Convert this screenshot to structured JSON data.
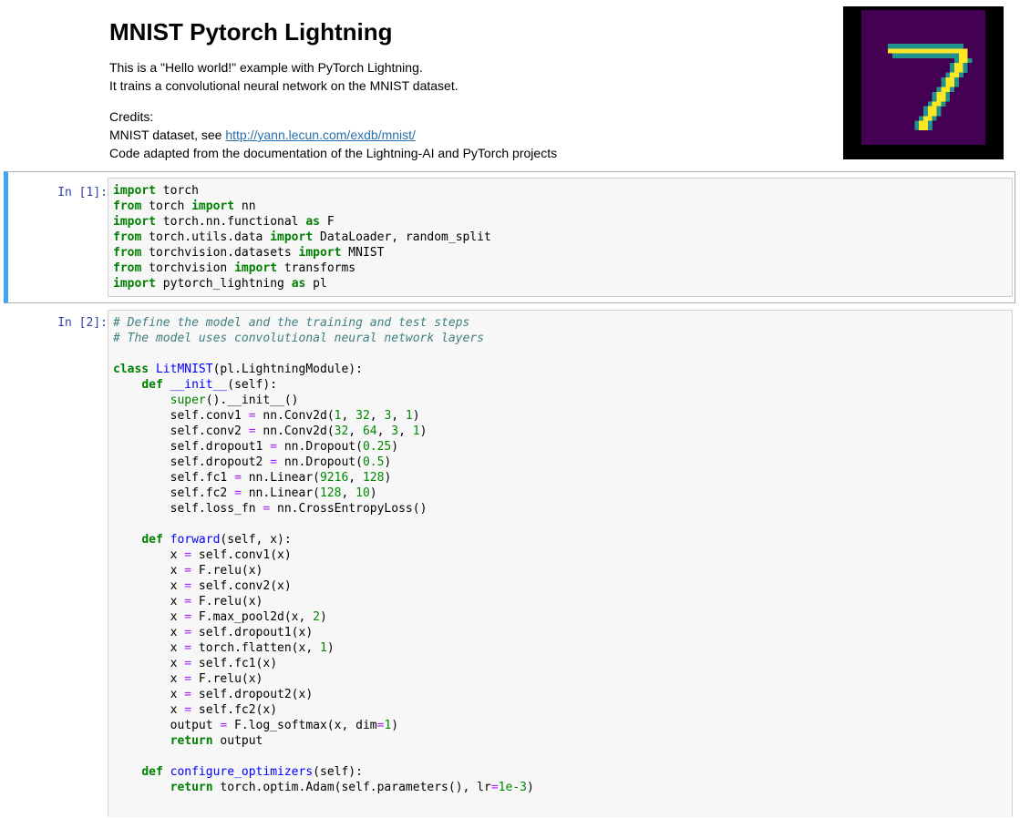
{
  "markdown": {
    "title": "MNIST Pytorch Lightning",
    "intro_line1": "This is a \"Hello world!\" example with PyTorch Lightning.",
    "intro_line2": "It trains a convolutional neural network on the MNIST dataset.",
    "credits_heading": "Credits:",
    "credits_dataset_prefix": "MNIST dataset, see ",
    "credits_dataset_link": "http://yann.lecun.com/exdb/mnist/",
    "credits_code": "Code adapted from the documentation of the Lightning-AI and PyTorch projects"
  },
  "image": {
    "description_colors": {
      "background": "#440154",
      "stroke": "#fde725",
      "edge": "#21918c"
    }
  },
  "cells": [
    {
      "prompt": "In [1]:",
      "lines": [
        [
          [
            "kw",
            "import"
          ],
          [
            "t",
            " torch"
          ]
        ],
        [
          [
            "kw",
            "from"
          ],
          [
            "t",
            " torch "
          ],
          [
            "kw",
            "import"
          ],
          [
            "t",
            " nn"
          ]
        ],
        [
          [
            "kw",
            "import"
          ],
          [
            "t",
            " torch.nn.functional "
          ],
          [
            "kw",
            "as"
          ],
          [
            "t",
            " F"
          ]
        ],
        [
          [
            "kw",
            "from"
          ],
          [
            "t",
            " torch.utils.data "
          ],
          [
            "kw",
            "import"
          ],
          [
            "t",
            " DataLoader, random_split"
          ]
        ],
        [
          [
            "kw",
            "from"
          ],
          [
            "t",
            " torchvision.datasets "
          ],
          [
            "kw",
            "import"
          ],
          [
            "t",
            " MNIST"
          ]
        ],
        [
          [
            "kw",
            "from"
          ],
          [
            "t",
            " torchvision "
          ],
          [
            "kw",
            "import"
          ],
          [
            "t",
            " transforms"
          ]
        ],
        [
          [
            "kw",
            "import"
          ],
          [
            "t",
            " pytorch_lightning "
          ],
          [
            "kw",
            "as"
          ],
          [
            "t",
            " pl"
          ]
        ]
      ]
    },
    {
      "prompt": "In [2]:",
      "lines": [
        [
          [
            "cm",
            "# Define the model and the training and test steps"
          ]
        ],
        [
          [
            "cm",
            "# The model uses convolutional neural network layers"
          ]
        ],
        [],
        [
          [
            "kw",
            "class"
          ],
          [
            "t",
            " "
          ],
          [
            "fn",
            "LitMNIST"
          ],
          [
            "t",
            "(pl.LightningModule):"
          ]
        ],
        [
          [
            "t",
            "    "
          ],
          [
            "kw",
            "def"
          ],
          [
            "t",
            " "
          ],
          [
            "fn",
            "__init__"
          ],
          [
            "t",
            "(self):"
          ]
        ],
        [
          [
            "t",
            "        "
          ],
          [
            "bi",
            "super"
          ],
          [
            "t",
            "().__init__()"
          ]
        ],
        [
          [
            "t",
            "        self.conv1 "
          ],
          [
            "op",
            "="
          ],
          [
            "t",
            " nn.Conv2d("
          ],
          [
            "num",
            "1"
          ],
          [
            "t",
            ", "
          ],
          [
            "num",
            "32"
          ],
          [
            "t",
            ", "
          ],
          [
            "num",
            "3"
          ],
          [
            "t",
            ", "
          ],
          [
            "num",
            "1"
          ],
          [
            "t",
            ")"
          ]
        ],
        [
          [
            "t",
            "        self.conv2 "
          ],
          [
            "op",
            "="
          ],
          [
            "t",
            " nn.Conv2d("
          ],
          [
            "num",
            "32"
          ],
          [
            "t",
            ", "
          ],
          [
            "num",
            "64"
          ],
          [
            "t",
            ", "
          ],
          [
            "num",
            "3"
          ],
          [
            "t",
            ", "
          ],
          [
            "num",
            "1"
          ],
          [
            "t",
            ")"
          ]
        ],
        [
          [
            "t",
            "        self.dropout1 "
          ],
          [
            "op",
            "="
          ],
          [
            "t",
            " nn.Dropout("
          ],
          [
            "num",
            "0.25"
          ],
          [
            "t",
            ")"
          ]
        ],
        [
          [
            "t",
            "        self.dropout2 "
          ],
          [
            "op",
            "="
          ],
          [
            "t",
            " nn.Dropout("
          ],
          [
            "num",
            "0.5"
          ],
          [
            "t",
            ")"
          ]
        ],
        [
          [
            "t",
            "        self.fc1 "
          ],
          [
            "op",
            "="
          ],
          [
            "t",
            " nn.Linear("
          ],
          [
            "num",
            "9216"
          ],
          [
            "t",
            ", "
          ],
          [
            "num",
            "128"
          ],
          [
            "t",
            ")"
          ]
        ],
        [
          [
            "t",
            "        self.fc2 "
          ],
          [
            "op",
            "="
          ],
          [
            "t",
            " nn.Linear("
          ],
          [
            "num",
            "128"
          ],
          [
            "t",
            ", "
          ],
          [
            "num",
            "10"
          ],
          [
            "t",
            ")"
          ]
        ],
        [
          [
            "t",
            "        self.loss_fn "
          ],
          [
            "op",
            "="
          ],
          [
            "t",
            " nn.CrossEntropyLoss()"
          ]
        ],
        [],
        [
          [
            "t",
            "    "
          ],
          [
            "kw",
            "def"
          ],
          [
            "t",
            " "
          ],
          [
            "fn",
            "forward"
          ],
          [
            "t",
            "(self, x):"
          ]
        ],
        [
          [
            "t",
            "        x "
          ],
          [
            "op",
            "="
          ],
          [
            "t",
            " self.conv1(x)"
          ]
        ],
        [
          [
            "t",
            "        x "
          ],
          [
            "op",
            "="
          ],
          [
            "t",
            " F.relu(x)"
          ]
        ],
        [
          [
            "t",
            "        x "
          ],
          [
            "op",
            "="
          ],
          [
            "t",
            " self.conv2(x)"
          ]
        ],
        [
          [
            "t",
            "        x "
          ],
          [
            "op",
            "="
          ],
          [
            "t",
            " F.relu(x)"
          ]
        ],
        [
          [
            "t",
            "        x "
          ],
          [
            "op",
            "="
          ],
          [
            "t",
            " F.max_pool2d(x, "
          ],
          [
            "num",
            "2"
          ],
          [
            "t",
            ")"
          ]
        ],
        [
          [
            "t",
            "        x "
          ],
          [
            "op",
            "="
          ],
          [
            "t",
            " self.dropout1(x)"
          ]
        ],
        [
          [
            "t",
            "        x "
          ],
          [
            "op",
            "="
          ],
          [
            "t",
            " torch.flatten(x, "
          ],
          [
            "num",
            "1"
          ],
          [
            "t",
            ")"
          ]
        ],
        [
          [
            "t",
            "        x "
          ],
          [
            "op",
            "="
          ],
          [
            "t",
            " self.fc1(x)"
          ]
        ],
        [
          [
            "t",
            "        x "
          ],
          [
            "op",
            "="
          ],
          [
            "t",
            " F.relu(x)"
          ]
        ],
        [
          [
            "t",
            "        x "
          ],
          [
            "op",
            "="
          ],
          [
            "t",
            " self.dropout2(x)"
          ]
        ],
        [
          [
            "t",
            "        x "
          ],
          [
            "op",
            "="
          ],
          [
            "t",
            " self.fc2(x)"
          ]
        ],
        [
          [
            "t",
            "        output "
          ],
          [
            "op",
            "="
          ],
          [
            "t",
            " F.log_softmax(x, dim"
          ],
          [
            "op",
            "="
          ],
          [
            "num",
            "1"
          ],
          [
            "t",
            ")"
          ]
        ],
        [
          [
            "t",
            "        "
          ],
          [
            "kw",
            "return"
          ],
          [
            "t",
            " output"
          ]
        ],
        [],
        [
          [
            "t",
            "    "
          ],
          [
            "kw",
            "def"
          ],
          [
            "t",
            " "
          ],
          [
            "fn",
            "configure_optimizers"
          ],
          [
            "t",
            "(self):"
          ]
        ],
        [
          [
            "t",
            "        "
          ],
          [
            "kw",
            "return"
          ],
          [
            "t",
            " torch.optim.Adam(self.parameters(), lr"
          ],
          [
            "op",
            "="
          ],
          [
            "num",
            "1e-3"
          ],
          [
            "t",
            ")"
          ]
        ]
      ]
    }
  ]
}
